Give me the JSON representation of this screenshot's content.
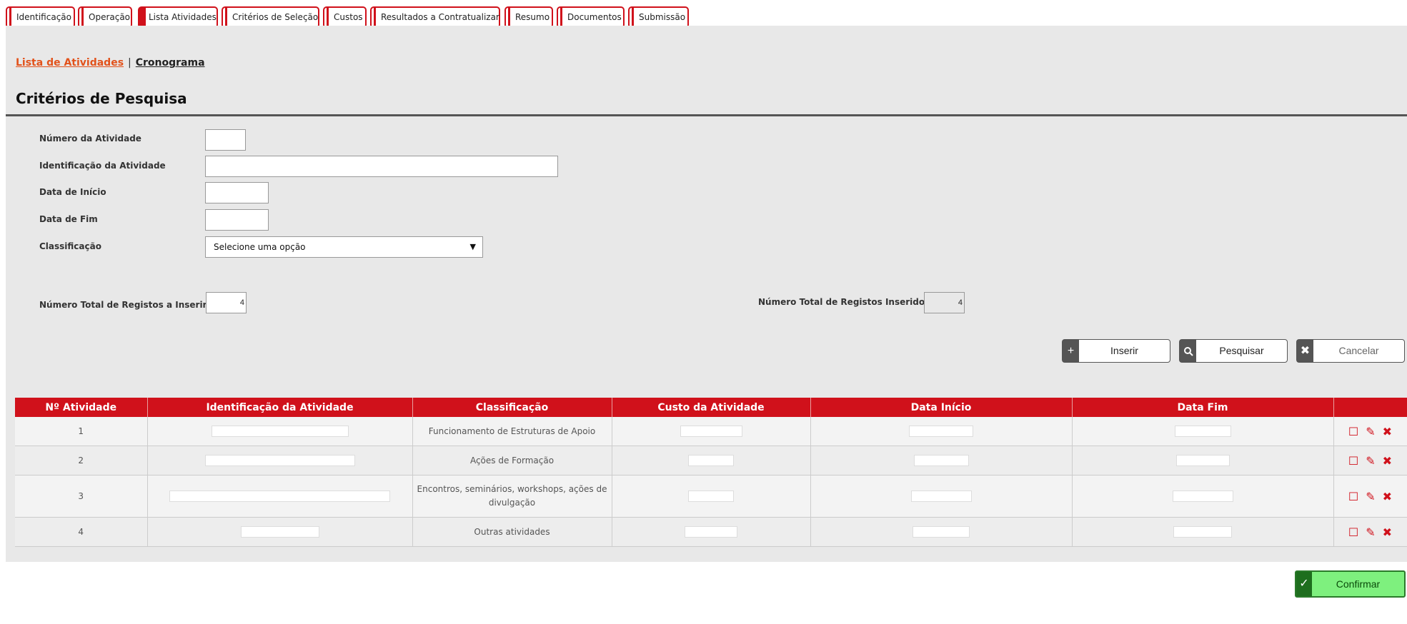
{
  "tabs": [
    {
      "label": "Identificação"
    },
    {
      "label": "Operação"
    },
    {
      "label": "Lista Atividades"
    },
    {
      "label": "Critérios de Seleção"
    },
    {
      "label": "Custos"
    },
    {
      "label": "Resultados a Contratualizar"
    },
    {
      "label": "Resumo"
    },
    {
      "label": "Documentos"
    },
    {
      "label": "Submissão"
    }
  ],
  "sublinks": {
    "active": "Lista de Atividades",
    "separator": "|",
    "other": "Cronograma"
  },
  "section_title": "Critérios de Pesquisa",
  "form": {
    "numero_label": "Número da Atividade",
    "identificacao_label": "Identificação da Atividade",
    "data_inicio_label": "Data de Início",
    "data_fim_label": "Data de Fim",
    "classificacao_label": "Classificação",
    "classificacao_value": "Selecione uma opção",
    "total_inserir_label": "Número Total de Registos a Inserir:",
    "total_inserir_required": "*",
    "total_inserir_value": "4",
    "total_inseridos_label": "Número Total de Registos Inseridos:",
    "total_inseridos_value": "4"
  },
  "buttons": {
    "inserir": "Inserir",
    "pesquisar": "Pesquisar",
    "cancelar": "Cancelar",
    "confirmar": "Confirmar"
  },
  "table": {
    "headers": [
      "Nº Atividade",
      "Identificação da Atividade",
      "Classificação",
      "Custo da Atividade",
      "Data Início",
      "Data Fim",
      ""
    ],
    "rows": [
      {
        "num": "1",
        "classificacao": "Funcionamento de Estruturas de Apoio"
      },
      {
        "num": "2",
        "classificacao": "Ações de Formação"
      },
      {
        "num": "3",
        "classificacao": "Encontros, seminários, workshops, ações de divulgação"
      },
      {
        "num": "4",
        "classificacao": "Outras atividades"
      }
    ]
  },
  "icons": {
    "accent": "#d0111b",
    "confirm_green": "#7ef07e"
  }
}
